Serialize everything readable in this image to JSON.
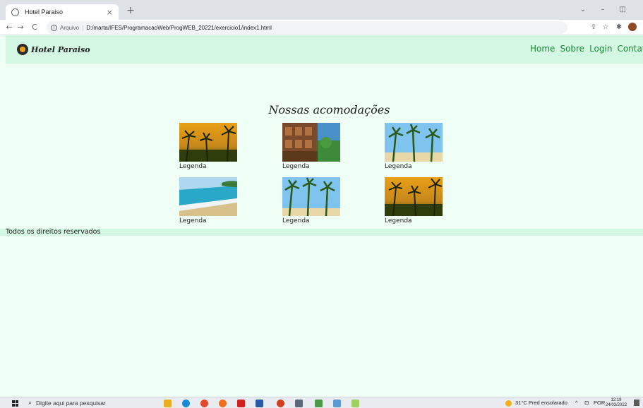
{
  "browser": {
    "tab_title": "Hotel Paraiso",
    "tab_close": "×",
    "new_tab": "+",
    "win_min": "⌄",
    "win_restore": "–",
    "win_max": "◫",
    "nav_back": "←",
    "nav_forward": "→",
    "nav_reload": "C",
    "info": "i",
    "security_label": "Arquivo",
    "separator": "|",
    "url": "D:/marta/IFES/ProgramacaoWeb/ProgWEB_20221/exercicio1/index1.html",
    "share": "⇪",
    "bookmark": "☆",
    "extensions": "✱"
  },
  "header": {
    "logo_text": "Hotel Paraiso",
    "nav": [
      "Home",
      "Sobre",
      "Login",
      "Contato"
    ]
  },
  "main": {
    "title": "Nossas acomodações",
    "cards": [
      {
        "caption": "Legenda",
        "image": "palm-sunset"
      },
      {
        "caption": "Legenda",
        "image": "wooden-cabins"
      },
      {
        "caption": "Legenda",
        "image": "palm-beach"
      },
      {
        "caption": "Legenda",
        "image": "coastline"
      },
      {
        "caption": "Legenda",
        "image": "palm-beach"
      },
      {
        "caption": "Legenda",
        "image": "palm-sunset"
      }
    ]
  },
  "footer": {
    "text": "Todos os direitos reservados"
  },
  "taskbar": {
    "search_placeholder": "Digite aqui para pesquisar",
    "weather": "31°C  Pred ensolarado",
    "language": "POR",
    "time": "12:19",
    "date": "24/03/2022"
  },
  "colors": {
    "page_background": "#f0fff5",
    "header_background": "#d4f7e3",
    "nav_link": "#1a8a38"
  }
}
